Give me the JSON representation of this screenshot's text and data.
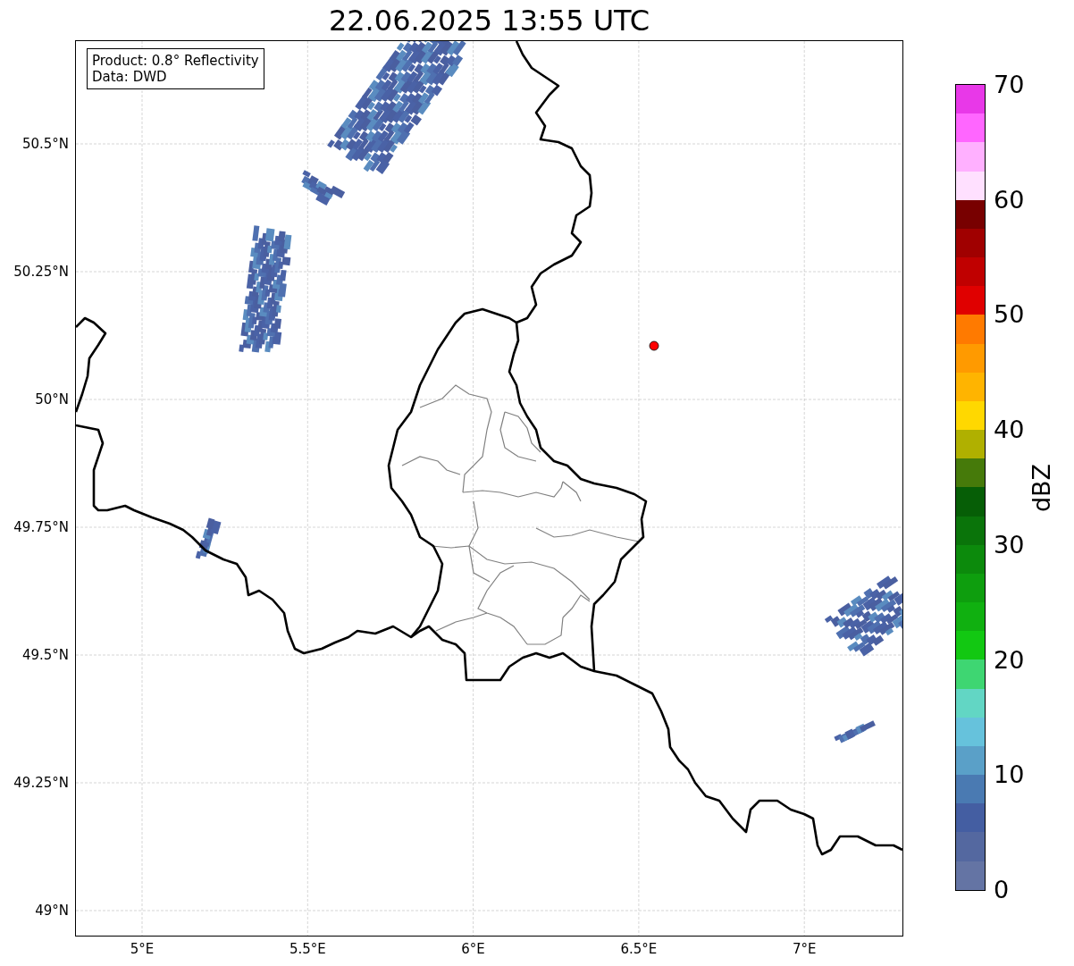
{
  "title": "22.06.2025 13:55 UTC",
  "info_box": {
    "lines": [
      "Product: 0.8° Reflectivity",
      "Data: DWD"
    ]
  },
  "map": {
    "y_ticks": [
      "50.5°N",
      "50.25°N",
      "50°N",
      "49.75°N",
      "49.5°N",
      "49.25°N",
      "49°N"
    ],
    "x_ticks": [
      "5°E",
      "5.5°E",
      "6°E",
      "6.5°E",
      "7°E"
    ]
  },
  "colorbar": {
    "label": "dBZ",
    "ticks": [
      "70",
      "60",
      "50",
      "40",
      "30",
      "20",
      "10",
      "0"
    ],
    "bands": [
      {
        "color": "#e838e8"
      },
      {
        "color": "#ff66ff"
      },
      {
        "color": "#ffb0ff"
      },
      {
        "color": "#ffe0ff"
      },
      {
        "color": "#780000"
      },
      {
        "color": "#a00000"
      },
      {
        "color": "#c00000"
      },
      {
        "color": "#e00000"
      },
      {
        "color": "#ff7a00"
      },
      {
        "color": "#ff9a00"
      },
      {
        "color": "#ffb400"
      },
      {
        "color": "#ffd800"
      },
      {
        "color": "#b0b000"
      },
      {
        "color": "#467a0a"
      },
      {
        "color": "#065e06"
      },
      {
        "color": "#0a740a"
      },
      {
        "color": "#0c8a0c"
      },
      {
        "color": "#0e9e0e"
      },
      {
        "color": "#10b010"
      },
      {
        "color": "#12c812"
      },
      {
        "color": "#3ed672"
      },
      {
        "color": "#62d6c4"
      },
      {
        "color": "#66c2dc"
      },
      {
        "color": "#5aa0c8"
      },
      {
        "color": "#4a7ab2"
      },
      {
        "color": "#445ea2"
      },
      {
        "color": "#5468a0"
      },
      {
        "color": "#6474a4"
      }
    ]
  }
}
